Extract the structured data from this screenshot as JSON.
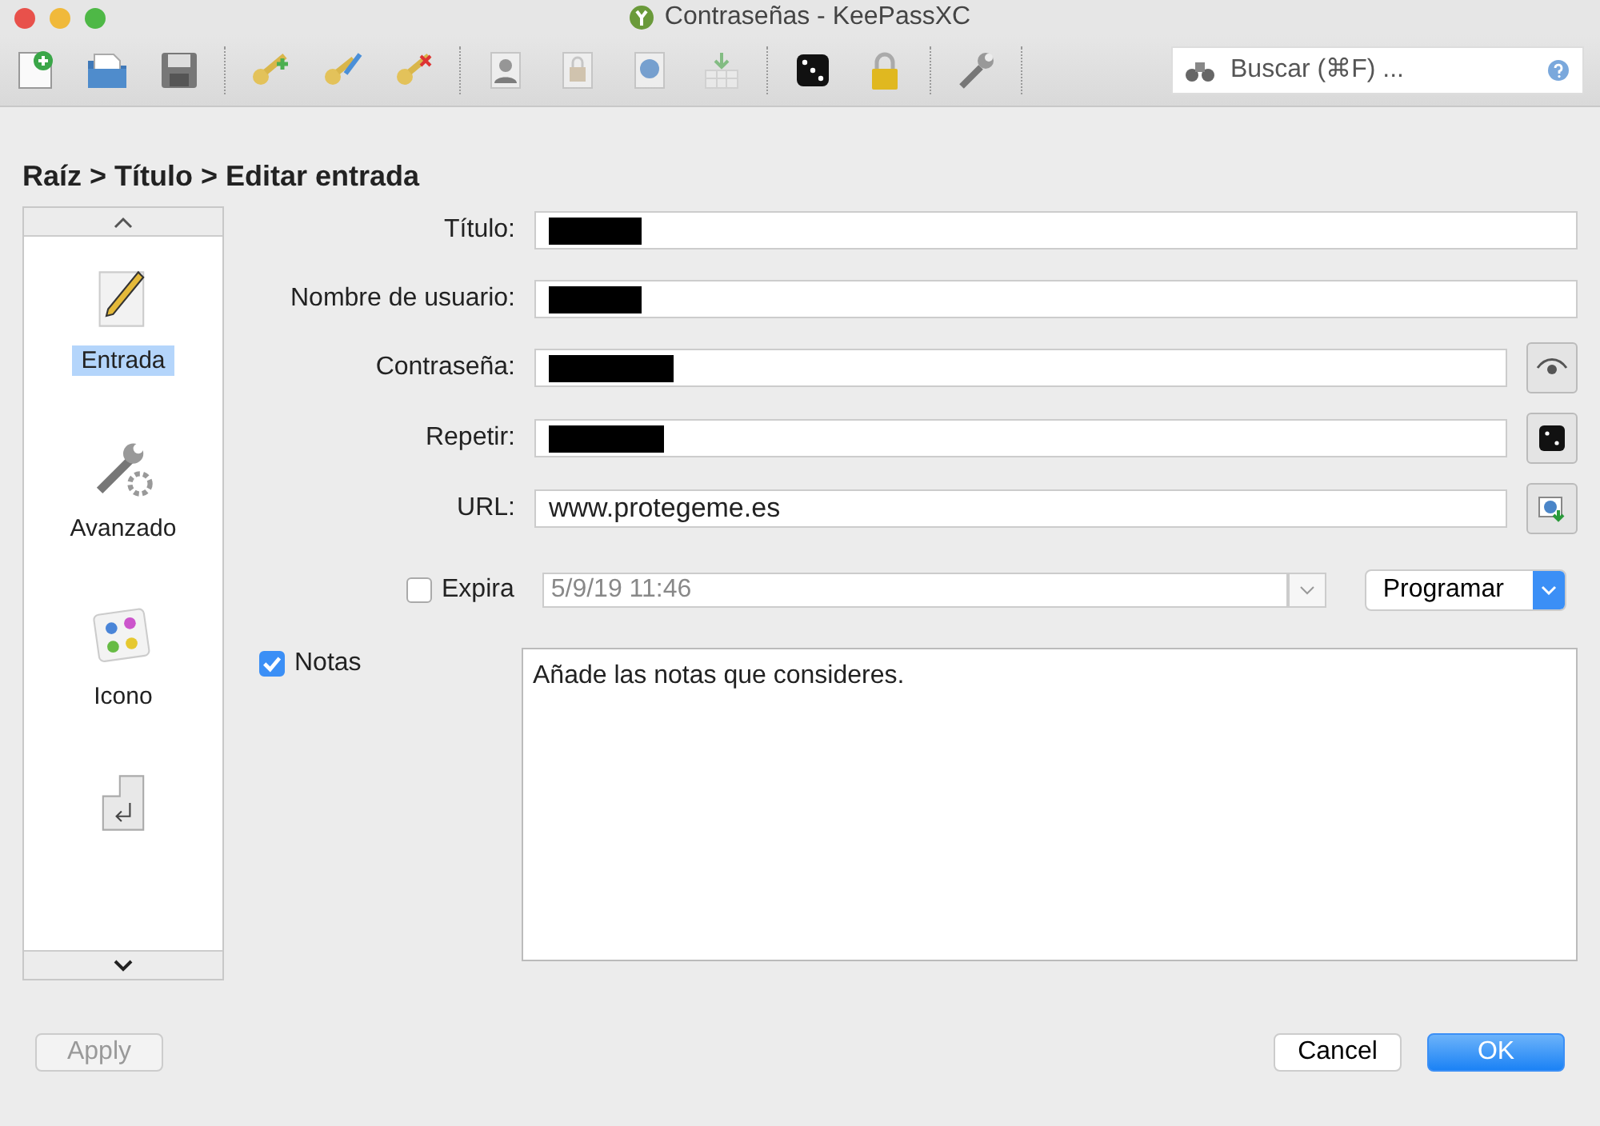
{
  "window": {
    "title": "Contraseñas - KeePassXC"
  },
  "toolbar": {
    "search": {
      "placeholder": "Buscar (⌘F) ..."
    }
  },
  "breadcrumb": "Raíz > Título  > Editar entrada",
  "sidebar": {
    "items": [
      {
        "label": "Entrada",
        "selected": true,
        "kind": "entry"
      },
      {
        "label": "Avanzado",
        "selected": false,
        "kind": "advanced"
      },
      {
        "label": "Icono",
        "selected": false,
        "kind": "icon"
      },
      {
        "kind": "autotype",
        "selected": false
      }
    ]
  },
  "fields": [
    {
      "label": "Título:",
      "kind": "title",
      "redacted": true
    },
    {
      "label": "Nombre de usuario:",
      "kind": "username",
      "redacted": true
    },
    {
      "label": "Contraseña:",
      "kind": "password",
      "redacted": true
    },
    {
      "label": "Repetir:",
      "kind": "repeat",
      "redacted": true
    },
    {
      "label": "URL:",
      "kind": "url",
      "redacted": false,
      "value": "www.protegeme.es"
    }
  ],
  "expiry": {
    "label": "Expira",
    "checked": false,
    "value": "5/9/19 11:46",
    "preset": "Programar"
  },
  "notes": {
    "label": "Notas",
    "checked": true,
    "value": "Añade las notas que consideres."
  },
  "buttons": {
    "apply": {
      "label": "Apply",
      "disabled": true
    },
    "cancel": {
      "label": "Cancel"
    },
    "ok": {
      "label": "OK"
    }
  }
}
